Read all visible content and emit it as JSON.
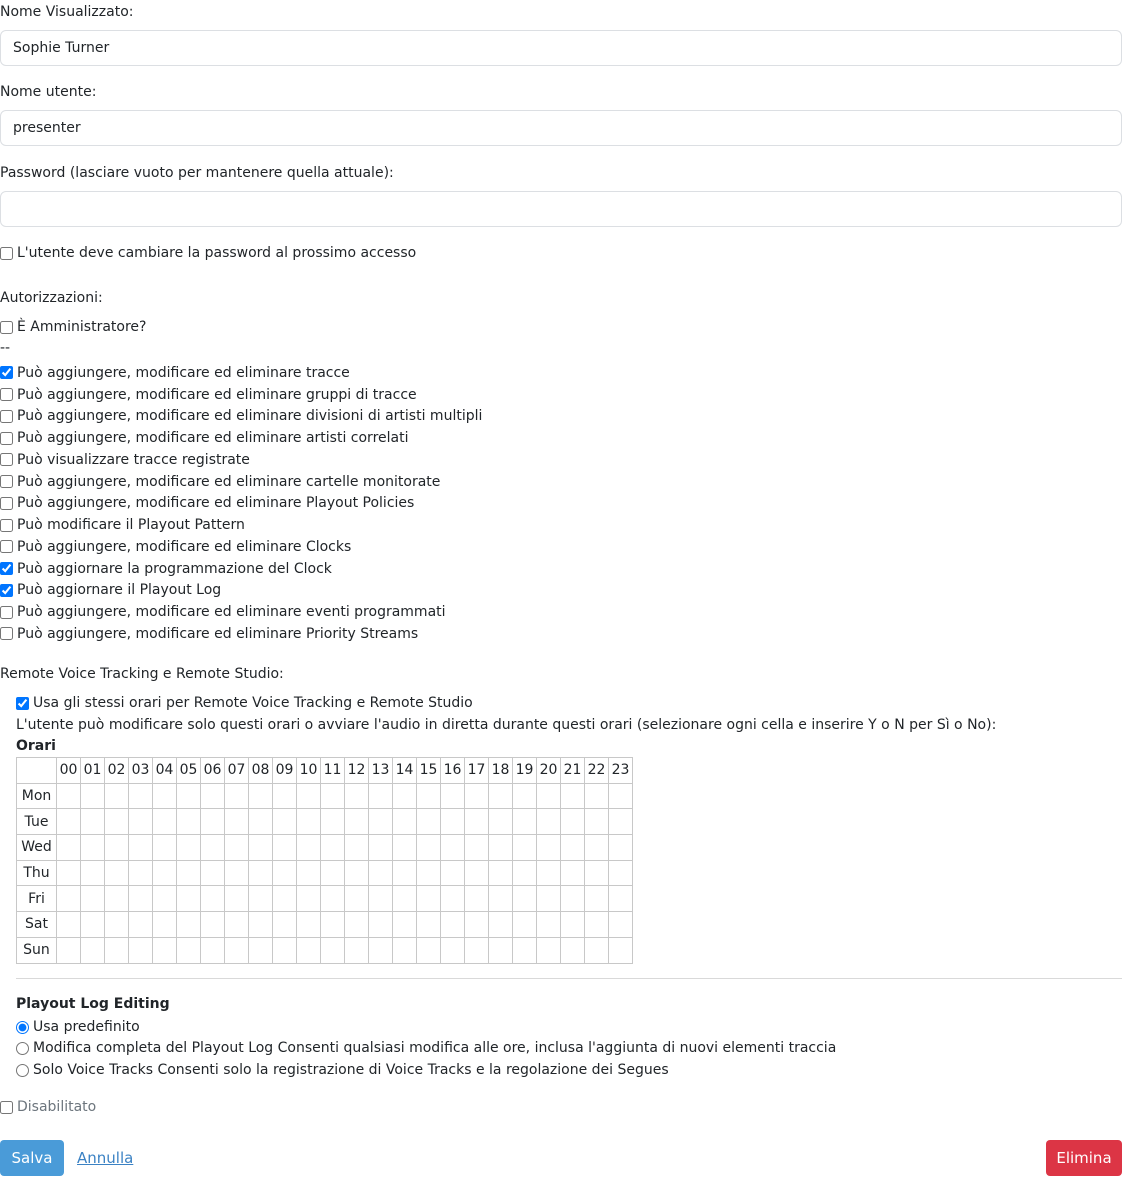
{
  "form": {
    "display_name_label": "Nome Visualizzato:",
    "display_name_value": "Sophie Turner",
    "username_label": "Nome utente:",
    "username_value": "presenter",
    "password_label": "Password (lasciare vuoto per mantenere quella attuale):",
    "password_value": "",
    "change_password_label": "L'utente deve cambiare la password al prossimo accesso",
    "change_password_checked": false
  },
  "permissions": {
    "heading": "Autorizzazioni:",
    "admin_label": "È Amministratore?",
    "admin_checked": false,
    "separator": "--",
    "items": [
      {
        "label": "Può aggiungere, modificare ed eliminare tracce",
        "checked": true
      },
      {
        "label": "Può aggiungere, modificare ed eliminare gruppi di tracce",
        "checked": false
      },
      {
        "label": "Può aggiungere, modificare ed eliminare divisioni di artisti multipli",
        "checked": false
      },
      {
        "label": "Può aggiungere, modificare ed eliminare artisti correlati",
        "checked": false
      },
      {
        "label": "Può visualizzare tracce registrate",
        "checked": false
      },
      {
        "label": "Può aggiungere, modificare ed eliminare cartelle monitorate",
        "checked": false
      },
      {
        "label": "Può aggiungere, modificare ed eliminare Playout Policies",
        "checked": false
      },
      {
        "label": "Può modificare il Playout Pattern",
        "checked": false
      },
      {
        "label": "Può aggiungere, modificare ed eliminare Clocks",
        "checked": false
      },
      {
        "label": "Può aggiornare la programmazione del Clock",
        "checked": true
      },
      {
        "label": "Può aggiornare il Playout Log",
        "checked": true
      },
      {
        "label": "Può aggiungere, modificare ed eliminare eventi programmati",
        "checked": false
      },
      {
        "label": "Può aggiungere, modificare ed eliminare Priority Streams",
        "checked": false
      }
    ]
  },
  "remote": {
    "heading": "Remote Voice Tracking e Remote Studio:",
    "same_hours_label": "Usa gli stessi orari per Remote Voice Tracking e Remote Studio",
    "same_hours_checked": true,
    "instructions": "L'utente può modificare solo questi orari o avviare l'audio in diretta durante questi orari (selezionare ogni cella e inserire Y o N per Sì o No):",
    "hours_title": "Orari",
    "hours": [
      "00",
      "01",
      "02",
      "03",
      "04",
      "05",
      "06",
      "07",
      "08",
      "09",
      "10",
      "11",
      "12",
      "13",
      "14",
      "15",
      "16",
      "17",
      "18",
      "19",
      "20",
      "21",
      "22",
      "23"
    ],
    "days": [
      "Mon",
      "Tue",
      "Wed",
      "Thu",
      "Fri",
      "Sat",
      "Sun"
    ]
  },
  "playout_editing": {
    "heading": "Playout Log Editing",
    "options": [
      {
        "label": "Usa predefinito",
        "checked": true
      },
      {
        "label": "Modifica completa del Playout Log Consenti qualsiasi modifica alle ore, inclusa l'aggiunta di nuovi elementi traccia",
        "checked": false
      },
      {
        "label": "Solo Voice Tracks Consenti solo la registrazione di Voice Tracks e la regolazione dei Segues",
        "checked": false
      }
    ]
  },
  "disabled": {
    "label": "Disabilitato",
    "checked": false
  },
  "actions": {
    "save": "Salva",
    "cancel": "Annulla",
    "delete": "Elimina"
  },
  "colors": {
    "save_button": "#4a9bd8",
    "delete_button": "#dc3545",
    "link": "#3b82c4"
  }
}
